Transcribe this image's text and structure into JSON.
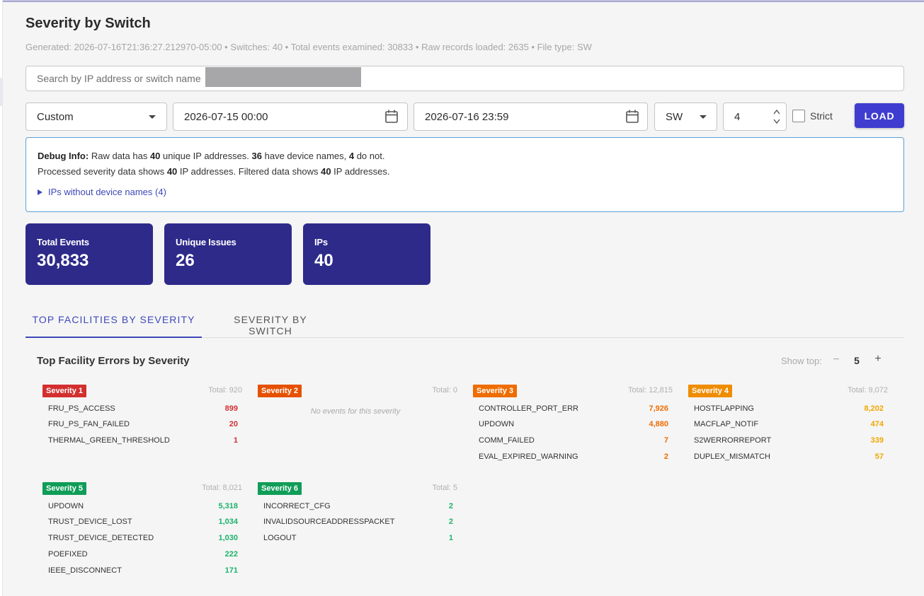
{
  "header": {
    "title": "Severity by Switch",
    "subtitle": "Generated: 2026-07-16T21:36:27.212970-05:00 • Switches: 40 • Total events examined: 30833 • Raw records loaded: 2635 • File type: SW"
  },
  "search": {
    "placeholder": "Search by IP address or switch name",
    "value": ""
  },
  "controls": {
    "range_select": "Custom",
    "start_datetime": "2026-07-15 00:00",
    "end_datetime": "2026-07-16 23:59",
    "type_select": "SW",
    "severity_number": "4",
    "strict_label": "Strict",
    "strict_checked": false,
    "load_label": "LOAD"
  },
  "debug": {
    "label": "Debug Info:",
    "l1_a": " Raw data has ",
    "l1_b": "40",
    "l1_c": " unique IP addresses. ",
    "l1_d": "36",
    "l1_e": " have device names, ",
    "l1_f": "4",
    "l1_g": " do not.",
    "l2_a": "Processed severity data shows ",
    "l2_b": "40",
    "l2_c": " IP addresses. Filtered data shows ",
    "l2_d": "40",
    "l2_e": " IP addresses.",
    "toggle": "IPs without device names (4)"
  },
  "stats": [
    {
      "label": "Total Events",
      "value": "30,833"
    },
    {
      "label": "Unique Issues",
      "value": "26"
    },
    {
      "label": "IPs",
      "value": "40"
    }
  ],
  "tabs": [
    {
      "label": "TOP FACILITIES BY SEVERITY",
      "active": true
    },
    {
      "label": "SEVERITY BY SWITCH",
      "active": false
    }
  ],
  "panel": {
    "title": "Top Facility Errors by Severity",
    "show_top_label": "Show top:",
    "minus": "−",
    "show_top_value": "5",
    "plus": "+"
  },
  "severities": [
    {
      "badge": "Severity 1",
      "total": "Total: 920",
      "color": "#d32f2f",
      "items": [
        {
          "name": "FRU_PS_ACCESS",
          "count": "899"
        },
        {
          "name": "FRU_PS_FAN_FAILED",
          "count": "20"
        },
        {
          "name": "THERMAL_GREEN_THRESHOLD",
          "count": "1"
        }
      ]
    },
    {
      "badge": "Severity 2",
      "total": "Total: 0",
      "color": "#e65100",
      "empty": "No events for this severity",
      "items": []
    },
    {
      "badge": "Severity 3",
      "total": "Total: 12,815",
      "color": "#ef6c00",
      "items": [
        {
          "name": "CONTROLLER_PORT_ERR",
          "count": "7,926"
        },
        {
          "name": "UPDOWN",
          "count": "4,880"
        },
        {
          "name": "COMM_FAILED",
          "count": "7"
        },
        {
          "name": "EVAL_EXPIRED_WARNING",
          "count": "2"
        }
      ]
    },
    {
      "badge": "Severity 4",
      "total": "Total: 9,072",
      "color": "#ef8c00",
      "count_color": "#f0a800",
      "items": [
        {
          "name": "HOSTFLAPPING",
          "count": "8,202"
        },
        {
          "name": "MACFLAP_NOTIF",
          "count": "474"
        },
        {
          "name": "S2WERRORREPORT",
          "count": "339"
        },
        {
          "name": "DUPLEX_MISMATCH",
          "count": "57"
        }
      ]
    },
    {
      "badge": "Severity 5",
      "total": "Total: 8,021",
      "color": "#0f9d58",
      "count_color": "#1db36b",
      "items": [
        {
          "name": "UPDOWN",
          "count": "5,318"
        },
        {
          "name": "TRUST_DEVICE_LOST",
          "count": "1,034"
        },
        {
          "name": "TRUST_DEVICE_DETECTED",
          "count": "1,030"
        },
        {
          "name": "POEFIXED",
          "count": "222"
        },
        {
          "name": "IEEE_DISCONNECT",
          "count": "171"
        }
      ]
    },
    {
      "badge": "Severity 6",
      "total": "Total: 5",
      "color": "#0f9d58",
      "count_color": "#1db36b",
      "items": [
        {
          "name": "INCORRECT_CFG",
          "count": "2"
        },
        {
          "name": "INVALIDSOURCEADDRESSPACKET",
          "count": "2"
        },
        {
          "name": "LOGOUT",
          "count": "1"
        }
      ]
    }
  ]
}
